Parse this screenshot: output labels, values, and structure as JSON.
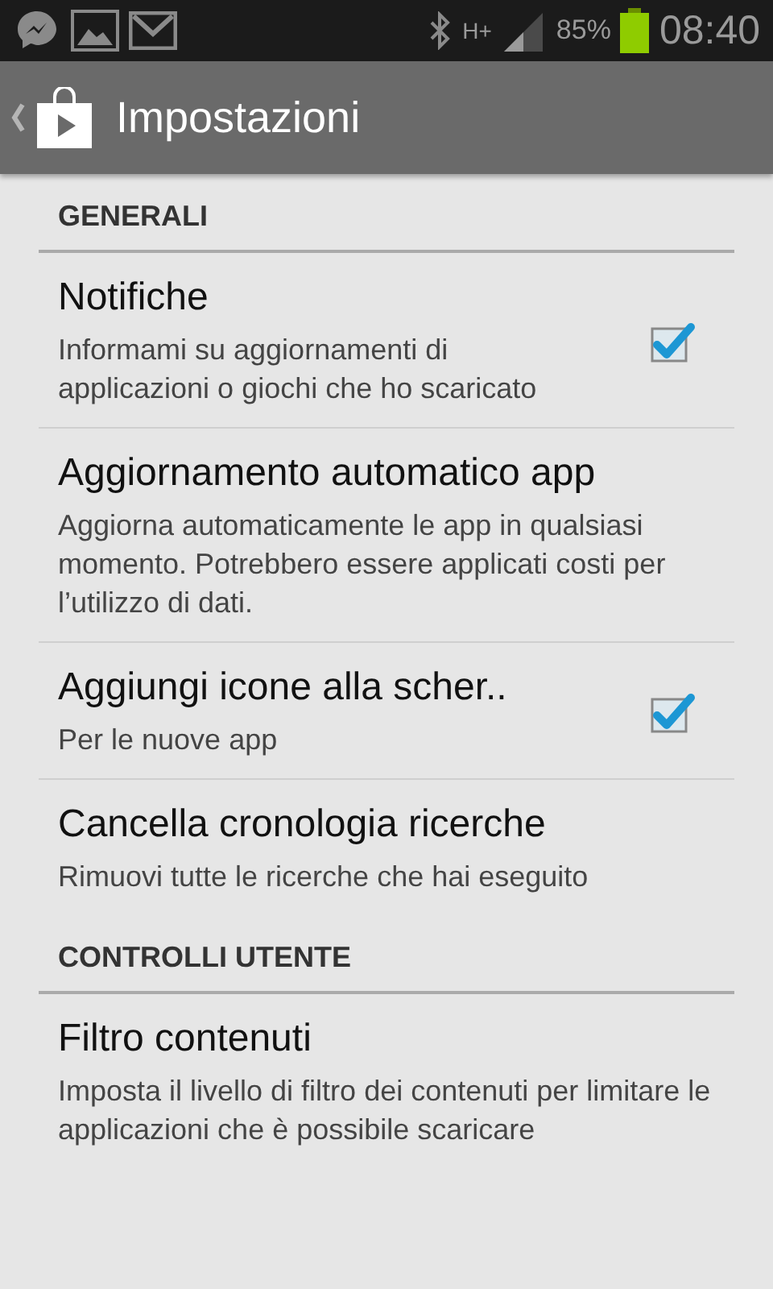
{
  "status_bar": {
    "network_type": "H+",
    "battery": "85%",
    "time": "08:40"
  },
  "action_bar": {
    "title": "Impostazioni"
  },
  "sections": [
    {
      "header": "GENERALI",
      "items": [
        {
          "kind": "checkbox",
          "title": "Notifiche",
          "description": "Informami su aggiornamenti di applicazioni o giochi che ho scaricato",
          "checked": true
        },
        {
          "kind": "plain",
          "title": "Aggiornamento automatico app",
          "description": "Aggiorna automaticamente le app in qualsiasi momento. Potrebbero essere applicati costi per l’utilizzo di dati."
        },
        {
          "kind": "checkbox",
          "title": "Aggiungi icone alla scher..",
          "description": "Per le nuove app",
          "checked": true
        },
        {
          "kind": "plain",
          "title": "Cancella cronologia ricerche",
          "description": "Rimuovi tutte le ricerche che hai eseguito"
        }
      ]
    },
    {
      "header": "CONTROLLI UTENTE",
      "items": [
        {
          "kind": "plain",
          "title": "Filtro contenuti",
          "description": "Imposta il livello di filtro dei contenuti per limitare le applicazioni che è possibile scaricare"
        }
      ]
    }
  ]
}
